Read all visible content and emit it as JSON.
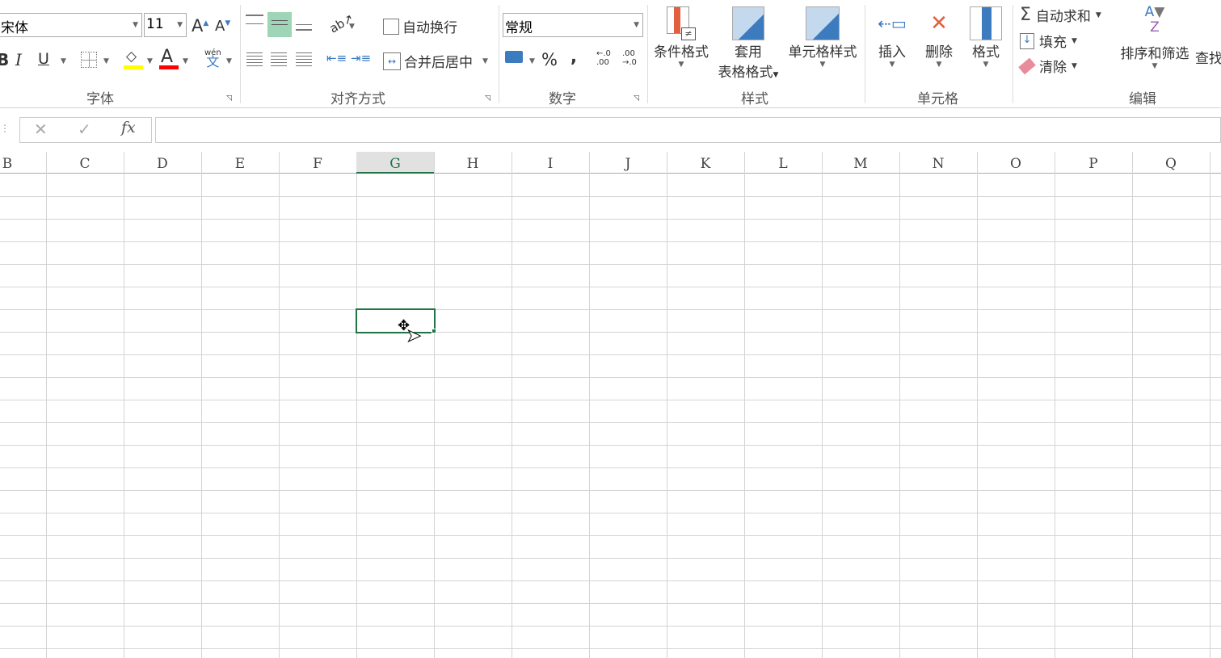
{
  "ribbon": {
    "font": {
      "name": "宋体",
      "size": "11",
      "group_label": "字体",
      "fill_color": "#ffff00",
      "font_color": "#ff0000",
      "phonetic_top": "wén",
      "phonetic_bottom": "文"
    },
    "alignment": {
      "wrap_text": "自动换行",
      "merge_center": "合并后居中",
      "group_label": "对齐方式"
    },
    "number": {
      "format": "常规",
      "percent": "%",
      "comma": ",",
      "inc_decimal": "←.0 .00",
      "dec_decimal": ".00 →.0",
      "group_label": "数字"
    },
    "styles": {
      "conditional": "条件格式",
      "table_line1": "套用",
      "table_line2": "表格格式",
      "cell_styles": "单元格样式",
      "group_label": "样式"
    },
    "cells": {
      "insert": "插入",
      "delete": "删除",
      "format": "格式",
      "group_label": "单元格"
    },
    "editing": {
      "autosum": "自动求和",
      "fill": "填充",
      "clear": "清除",
      "sort_filter": "排序和筛选",
      "find": "查找",
      "group_label": "编辑"
    }
  },
  "formula_bar": {
    "cancel": "✕",
    "enter": "✓",
    "fx": "fx",
    "value": ""
  },
  "sheet": {
    "columns": [
      "B",
      "C",
      "D",
      "E",
      "F",
      "G",
      "H",
      "I",
      "J",
      "K",
      "L",
      "M",
      "N",
      "O",
      "P",
      "Q"
    ],
    "selected_column": "G",
    "selected_cell": "G7",
    "accent": "#217346"
  }
}
